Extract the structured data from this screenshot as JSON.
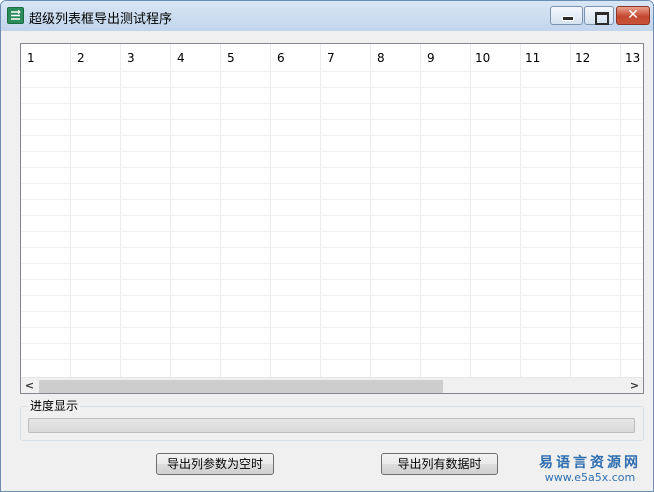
{
  "window": {
    "title": "超级列表框导出测试程序",
    "controls": {
      "minimize": "minimize-icon",
      "maximize": "maximize-icon",
      "close": "✕"
    }
  },
  "grid": {
    "columns": [
      "1",
      "2",
      "3",
      "4",
      "5",
      "6",
      "7",
      "8",
      "9",
      "10",
      "11",
      "12",
      "13"
    ],
    "row_count": 19,
    "scrollbar": {
      "left_arrow": "<",
      "right_arrow": ">"
    }
  },
  "progress": {
    "label": "进度显示",
    "value": 0,
    "fill_color": "#06b025"
  },
  "buttons": {
    "export_empty": "导出列参数为空时",
    "export_with_data": "导出列有数据时"
  },
  "watermark": {
    "main": "易语言资源网",
    "sub": "www.e5a5x.com",
    "color": "#2f6fb0"
  }
}
